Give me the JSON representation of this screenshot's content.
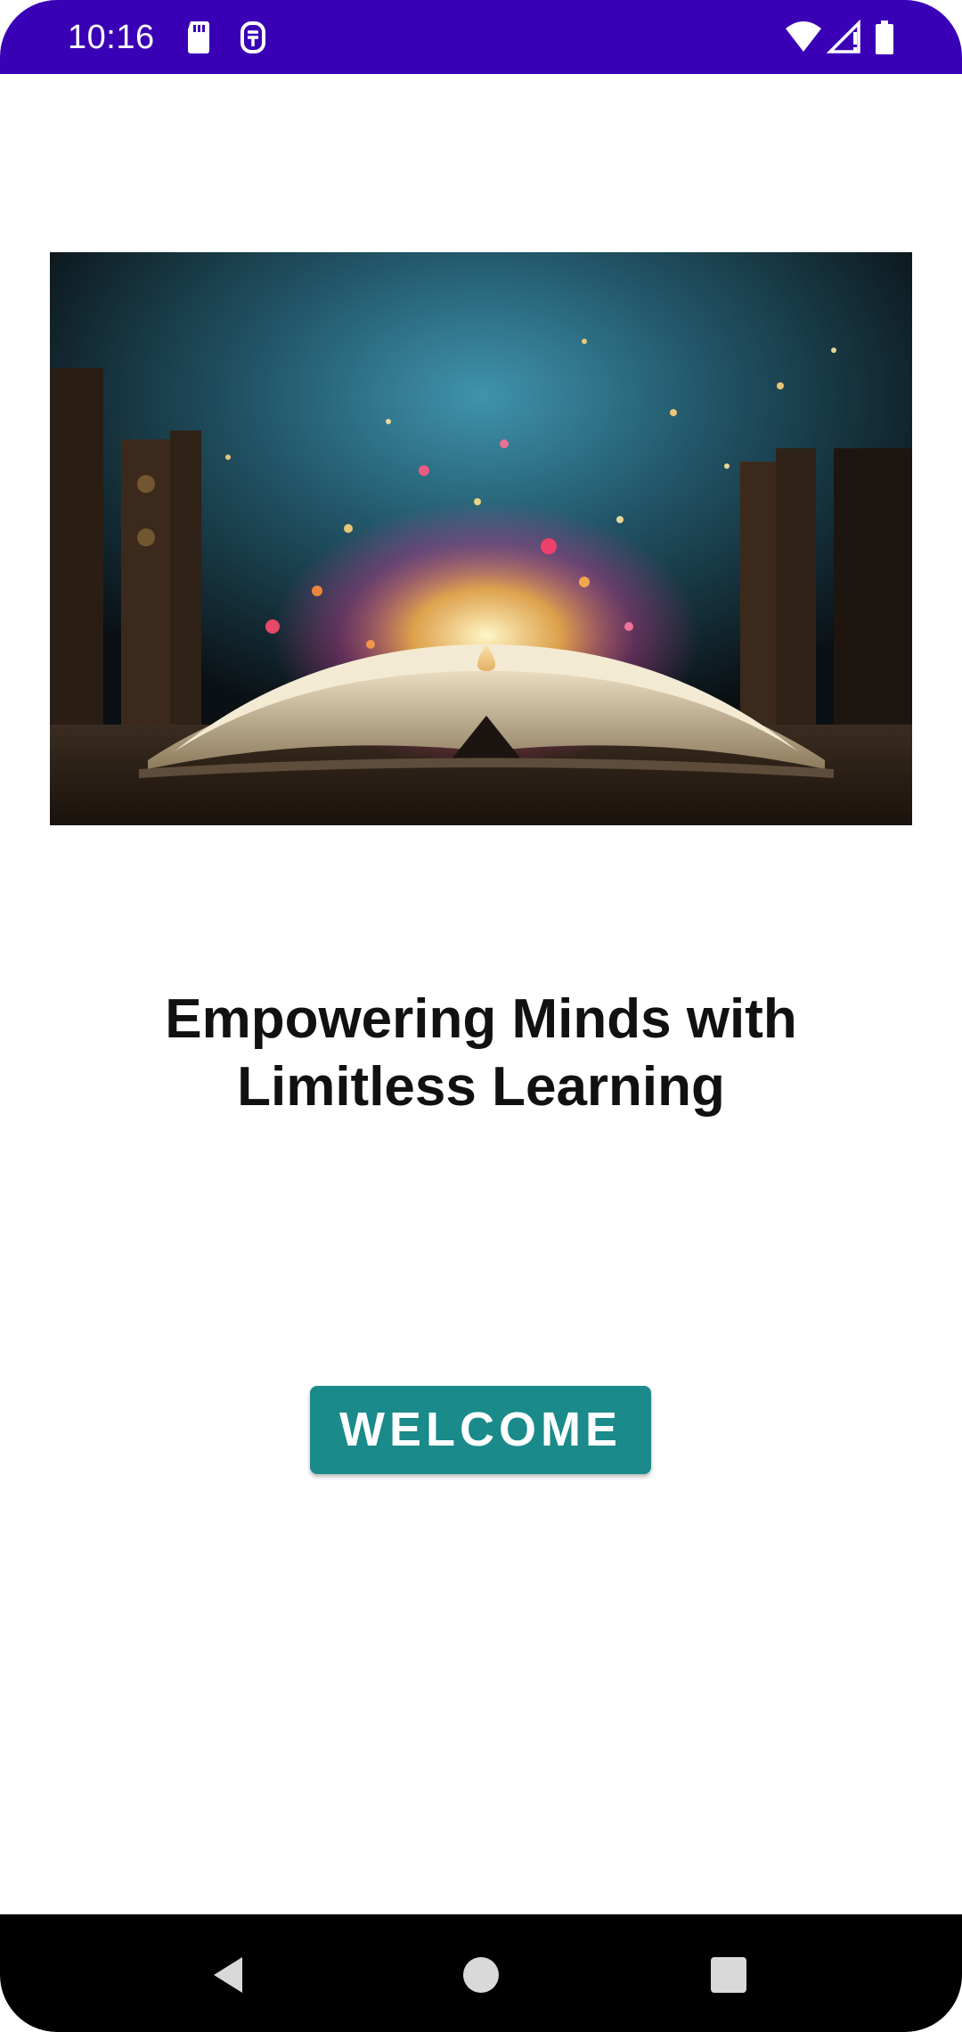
{
  "status_bar": {
    "time": "10:16",
    "background": "#3a00b5",
    "icons": [
      "sd-card-icon",
      "sim-status-icon",
      "wifi-icon",
      "cell-signal-icon",
      "battery-icon"
    ]
  },
  "hero": {
    "image_description_icon": "open-book-illustration"
  },
  "tagline": "Empowering Minds with Limitless Learning",
  "welcome_button": {
    "label": "WELCOME",
    "color": "#1a8a8a"
  },
  "nav_bar": {
    "icons": [
      "back-icon",
      "home-icon",
      "recents-icon"
    ]
  }
}
